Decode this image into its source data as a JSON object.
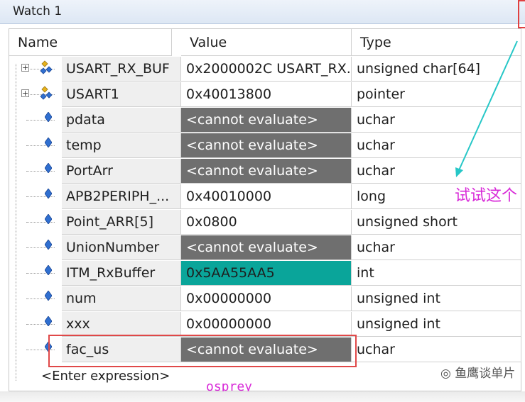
{
  "window": {
    "title": "Watch 1"
  },
  "columns": {
    "name": "Name",
    "value": "Value",
    "type": "Type"
  },
  "rows": [
    {
      "name": "USART_RX_BUF",
      "value": "0x2000002C USART_RX...",
      "type": "unsigned char[64]",
      "kind": "struct",
      "state": "normal"
    },
    {
      "name": "USART1",
      "value": "0x40013800",
      "type": "pointer",
      "kind": "struct",
      "state": "normal"
    },
    {
      "name": "pdata",
      "value": "<cannot evaluate>",
      "type": "uchar",
      "kind": "var",
      "state": "error"
    },
    {
      "name": "temp",
      "value": "<cannot evaluate>",
      "type": "uchar",
      "kind": "var",
      "state": "error"
    },
    {
      "name": "PortArr",
      "value": "<cannot evaluate>",
      "type": "uchar",
      "kind": "var",
      "state": "error"
    },
    {
      "name": "APB2PERIPH_...",
      "value": "0x40010000",
      "type": "long",
      "kind": "var",
      "state": "normal"
    },
    {
      "name": "Point_ARR[5]",
      "value": "0x0800",
      "type": "unsigned short",
      "kind": "var",
      "state": "normal"
    },
    {
      "name": "UnionNumber",
      "value": "<cannot evaluate>",
      "type": "uchar",
      "kind": "var",
      "state": "error"
    },
    {
      "name": "ITM_RxBuffer",
      "value": "0x5AA55AA5",
      "type": "int",
      "kind": "var",
      "state": "highlight"
    },
    {
      "name": "num",
      "value": "0x00000000",
      "type": "unsigned int",
      "kind": "var",
      "state": "normal"
    },
    {
      "name": "xxx",
      "value": "0x00000000",
      "type": "unsigned int",
      "kind": "var",
      "state": "normal"
    },
    {
      "name": "fac_us",
      "value": "<cannot evaluate>",
      "type": "uchar",
      "kind": "var",
      "state": "error"
    }
  ],
  "enter_expression": "<Enter expression>",
  "annotations": {
    "note": "osprey",
    "side_note": "试试这个",
    "watermark": "鱼鹰谈单片"
  },
  "colors": {
    "error_bg": "#6f6f6f",
    "highlight_bg": "#0aa59a",
    "annotation": "#d82ad8",
    "box": "#e04848"
  }
}
